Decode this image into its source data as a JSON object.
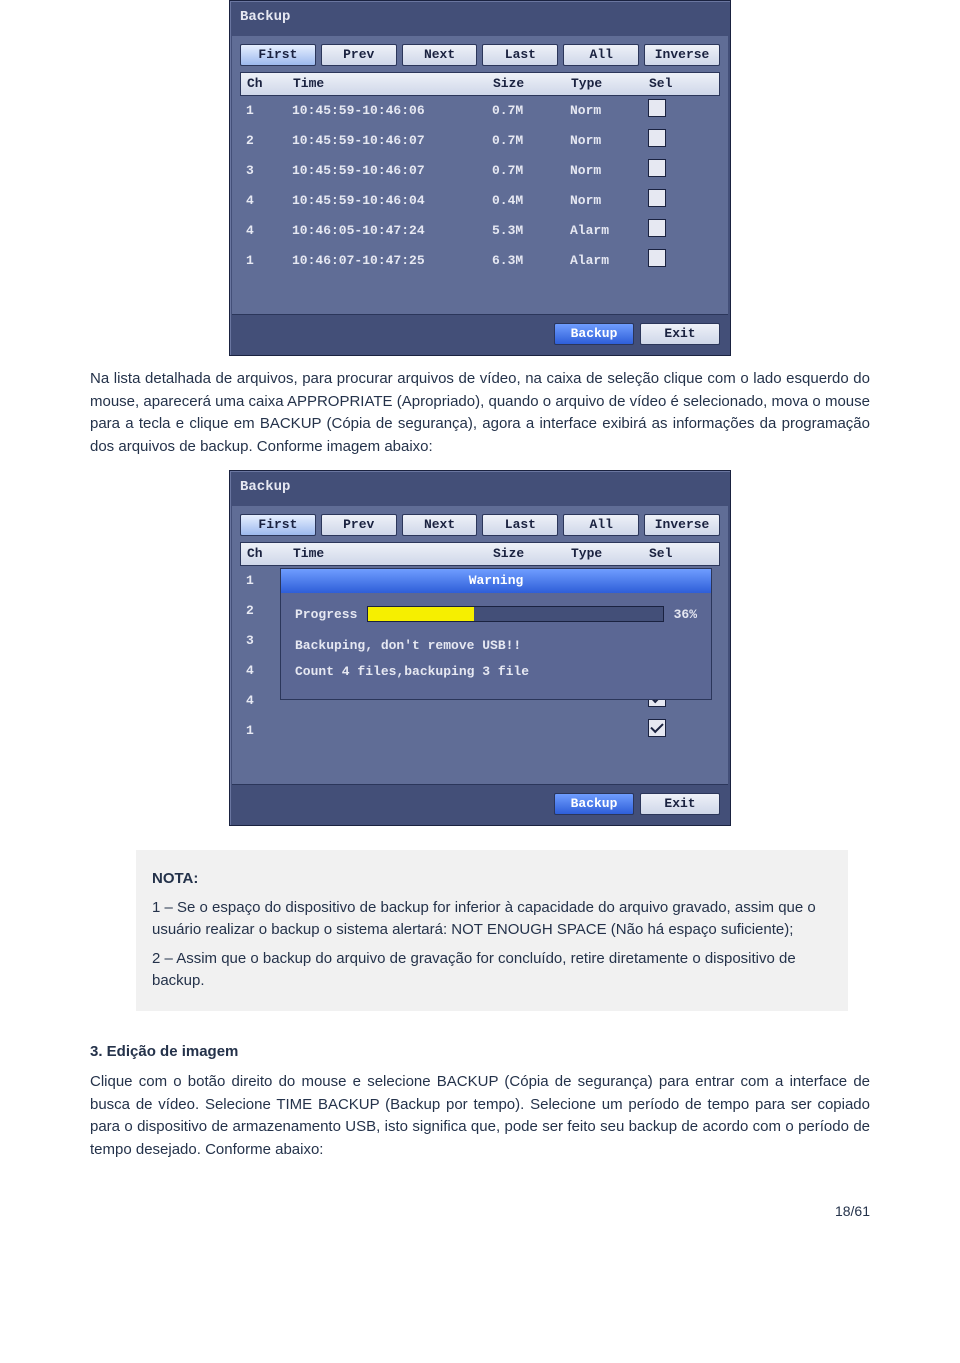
{
  "screenshot1": {
    "title": "Backup",
    "nav": [
      "First",
      "Prev",
      "Next",
      "Last",
      "All",
      "Inverse"
    ],
    "headers": {
      "ch": "Ch",
      "time": "Time",
      "size": "Size",
      "type": "Type",
      "sel": "Sel"
    },
    "rows": [
      {
        "ch": "1",
        "time": "10:45:59-10:46:06",
        "size": "0.7M",
        "type": "Norm",
        "checked": false
      },
      {
        "ch": "2",
        "time": "10:45:59-10:46:07",
        "size": "0.7M",
        "type": "Norm",
        "checked": false
      },
      {
        "ch": "3",
        "time": "10:45:59-10:46:07",
        "size": "0.7M",
        "type": "Norm",
        "checked": false
      },
      {
        "ch": "4",
        "time": "10:45:59-10:46:04",
        "size": "0.4M",
        "type": "Norm",
        "checked": false
      },
      {
        "ch": "4",
        "time": "10:46:05-10:47:24",
        "size": "5.3M",
        "type": "Alarm",
        "checked": false
      },
      {
        "ch": "1",
        "time": "10:46:07-10:47:25",
        "size": "6.3M",
        "type": "Alarm",
        "checked": false
      }
    ],
    "footer": {
      "backup": "Backup",
      "exit": "Exit"
    }
  },
  "para1": "Na lista detalhada de arquivos, para procurar arquivos de vídeo, na caixa de seleção clique com o lado esquerdo do mouse, aparecerá uma caixa APPROPRIATE (Apropriado), quando o arquivo de vídeo é selecionado, mova o mouse para a tecla e clique em BACKUP (Cópia de segurança), agora a interface exibirá as informações da programação dos arquivos de backup. Conforme imagem abaixo:",
  "screenshot2": {
    "title": "Backup",
    "nav": [
      "First",
      "Prev",
      "Next",
      "Last",
      "All",
      "Inverse"
    ],
    "headers": {
      "ch": "Ch",
      "time": "Time",
      "size": "Size",
      "type": "Type",
      "sel": "Sel"
    },
    "rows_ch": [
      "1",
      "2",
      "3",
      "4",
      "4",
      "1"
    ],
    "rows_checked": [
      false,
      false,
      true,
      true,
      true,
      true
    ],
    "warning": {
      "title": "Warning",
      "progress_label": "Progress",
      "progress_pct": "36%",
      "line1": "Backuping, don't remove USB!!",
      "line2": "Count 4 files,backuping 3 file"
    },
    "footer": {
      "backup": "Backup",
      "exit": "Exit"
    }
  },
  "note": {
    "heading": "NOTA:",
    "item1": "1 – Se o espaço do dispositivo de backup for inferior à capacidade do arquivo gravado, assim que o usuário realizar o backup o sistema alertará: NOT ENOUGH SPACE (Não há espaço suficiente);",
    "item2": "2 – Assim que o backup do arquivo de gravação for concluído, retire diretamente o dispositivo de backup."
  },
  "section3": {
    "heading": "3.    Edição de imagem",
    "body": "Clique com o botão direito do mouse e selecione BACKUP (Cópia de segurança)  para entrar com a interface de busca de vídeo. Selecione TIME BACKUP (Backup por tempo). Selecione um período de tempo para ser copiado para o dispositivo de armazenamento USB, isto significa que, pode ser feito seu backup de acordo com o período de tempo desejado. Conforme abaixo:"
  },
  "pagenum": "18/61"
}
